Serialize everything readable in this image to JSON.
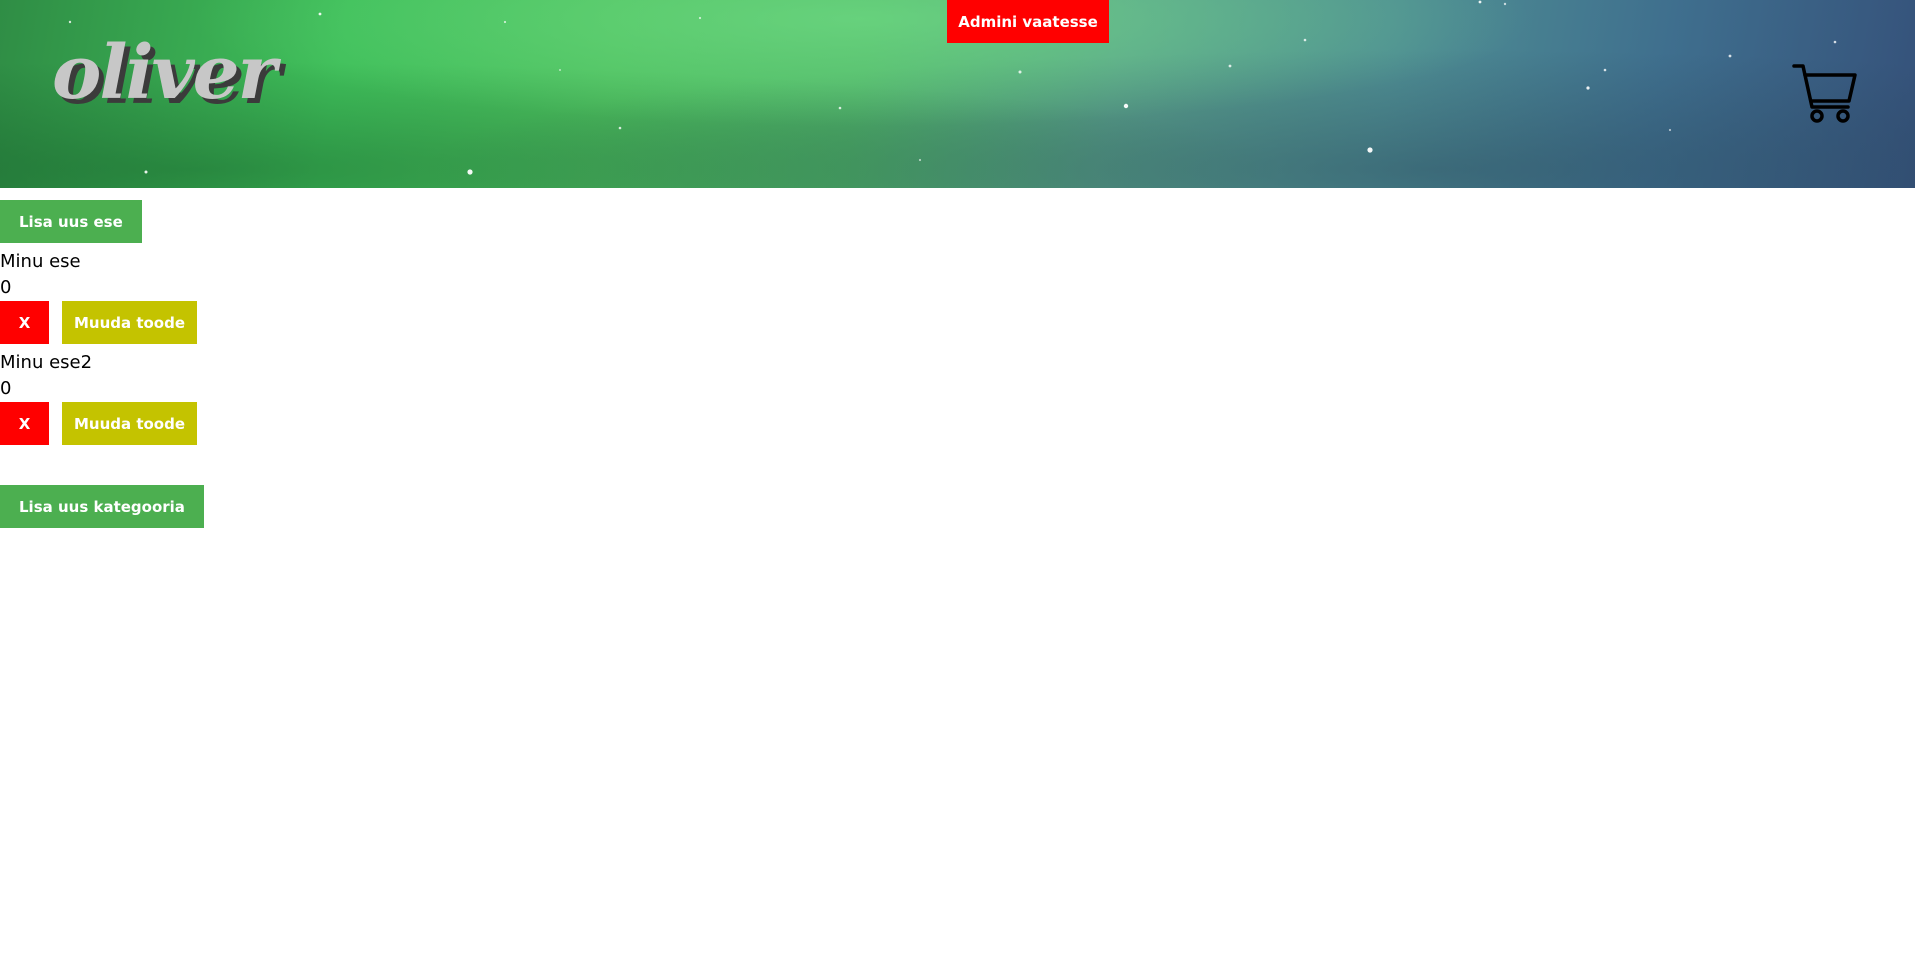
{
  "header": {
    "logo_text": "oliver",
    "admin_button_label": "Admini vaatesse",
    "cart_icon": "cart-icon",
    "admin_button_color": "#ff0000",
    "background_theme": "green aurora night sky"
  },
  "main": {
    "add_item_label": "Lisa uus ese",
    "items": [
      {
        "name": "Minu ese",
        "price": "0",
        "delete_label": "X",
        "edit_label": "Muuda toode"
      },
      {
        "name": "Minu ese2",
        "price": "0",
        "delete_label": "X",
        "edit_label": "Muuda toode"
      }
    ],
    "add_category_label": "Lisa uus kategooria"
  },
  "colors": {
    "primary_green": "#4caf50",
    "danger_red": "#ff0000",
    "edit_yellow": "#c4c300"
  }
}
